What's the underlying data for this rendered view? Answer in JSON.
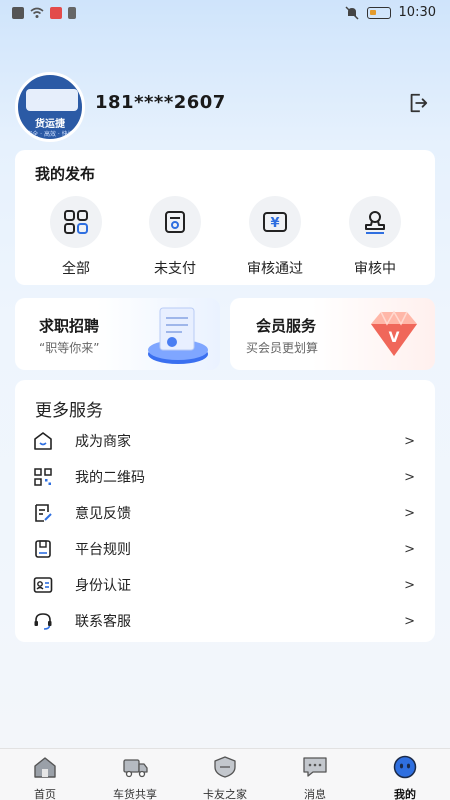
{
  "status_bar": {
    "time": "10:30"
  },
  "profile": {
    "avatar_brand": "货运捷",
    "avatar_sub": "安全 · 高效 · 快捷",
    "phone": "181****2607"
  },
  "publish": {
    "title": "我的发布",
    "items": [
      {
        "label": "全部",
        "icon": "grid-icon"
      },
      {
        "label": "未支付",
        "icon": "wallet-icon"
      },
      {
        "label": "审核通过",
        "icon": "yen-icon"
      },
      {
        "label": "审核中",
        "icon": "stamp-icon"
      }
    ]
  },
  "promos": {
    "job": {
      "title": "求职招聘",
      "subtitle": "“职等你来”"
    },
    "vip": {
      "title": "会员服务",
      "subtitle": "买会员更划算"
    }
  },
  "more": {
    "title": "更多服务",
    "items": [
      {
        "label": "成为商家",
        "chevron": ">"
      },
      {
        "label": "我的二维码",
        "chevron": ">"
      },
      {
        "label": "意见反馈",
        "chevron": ">"
      },
      {
        "label": "平台规则",
        "chevron": ">"
      },
      {
        "label": "身份认证",
        "chevron": ">"
      },
      {
        "label": "联系客服",
        "chevron": ">"
      }
    ]
  },
  "tabbar": {
    "items": [
      {
        "label": "首页"
      },
      {
        "label": "车货共享"
      },
      {
        "label": "卡友之家"
      },
      {
        "label": "消息"
      },
      {
        "label": "我的"
      }
    ],
    "active": "我的"
  },
  "colors": {
    "accent": "#2f6fe0",
    "brand_blue": "#2b5aa5"
  }
}
